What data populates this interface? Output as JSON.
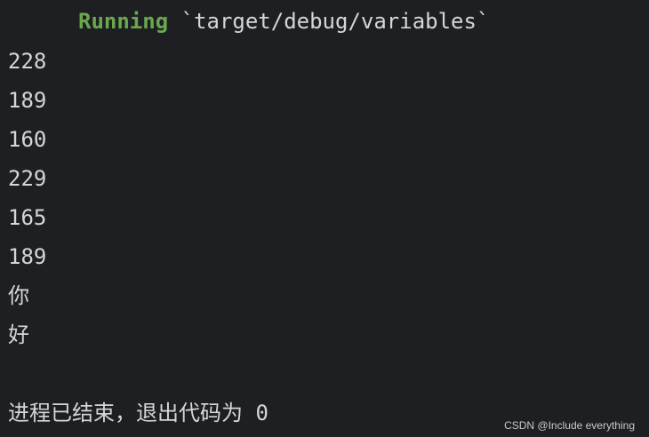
{
  "console": {
    "running_keyword": "Running",
    "running_path": "`target/debug/variables`",
    "output_lines": [
      "228",
      "189",
      "160",
      "229",
      "165",
      "189",
      "你",
      "好"
    ],
    "exit_message": "进程已结束，退出代码为 0"
  },
  "watermark": "CSDN @Include everything",
  "colors": {
    "background": "#1e1f22",
    "text": "#d4d6da",
    "running_keyword": "#6aa84f"
  }
}
